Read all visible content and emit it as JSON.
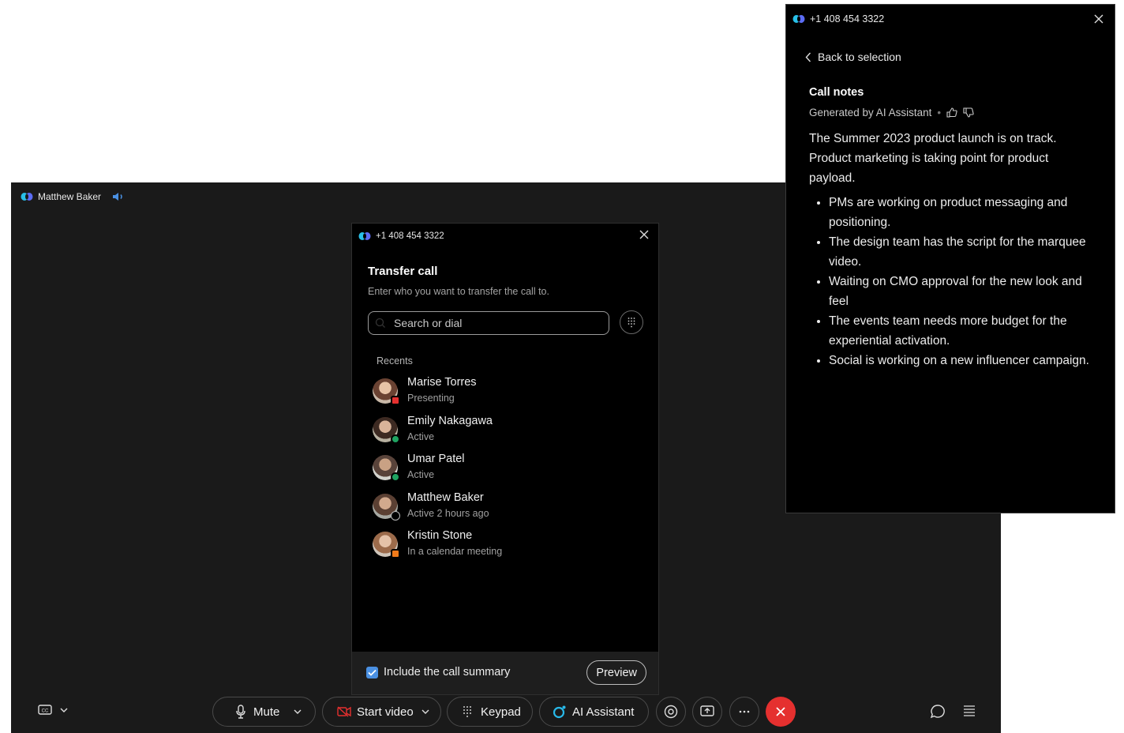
{
  "call_window": {
    "caller_name": "Matthew Baker"
  },
  "transfer_dialog": {
    "number": "+1 408 454 3322",
    "title": "Transfer call",
    "subtitle": "Enter who you want to transfer the call to.",
    "search_placeholder": "Search or dial",
    "recents_label": "Recents",
    "recents": [
      {
        "name": "Marise Torres",
        "status": "Presenting",
        "presence": "presenting"
      },
      {
        "name": "Emily Nakagawa",
        "status": "Active",
        "presence": "active"
      },
      {
        "name": "Umar Patel",
        "status": "Active",
        "presence": "active"
      },
      {
        "name": "Matthew Baker",
        "status": "Active 2 hours ago",
        "presence": "away"
      },
      {
        "name": "Kristin Stone",
        "status": "In a calendar meeting",
        "presence": "meeting"
      }
    ],
    "include_summary_label": "Include the call summary",
    "include_summary_checked": true,
    "preview_label": "Preview"
  },
  "controls": {
    "mute_label": "Mute",
    "start_video_label": "Start video",
    "keypad_label": "Keypad",
    "ai_assistant_label": "AI Assistant",
    "end_call_color": "#e5302f"
  },
  "notes_panel": {
    "number": "+1 408 454 3322",
    "back_label": "Back to selection",
    "title": "Call notes",
    "generated_by": "Generated by AI Assistant",
    "summary": "The Summer 2023 product launch is on track. Product marketing is taking point for product payload.",
    "bullets": [
      "PMs are working on product messaging and positioning.",
      "The design team has the script for the marquee video.",
      "Waiting on CMO approval for the new look and feel",
      "The events team needs more budget for the experiential activation.",
      "Social is working on a new influencer campaign."
    ]
  },
  "colors": {
    "accent_blue": "#4a90e2",
    "active_green": "#1fa361",
    "presenting_red": "#e5302f",
    "meeting_orange": "#f07a1a"
  }
}
